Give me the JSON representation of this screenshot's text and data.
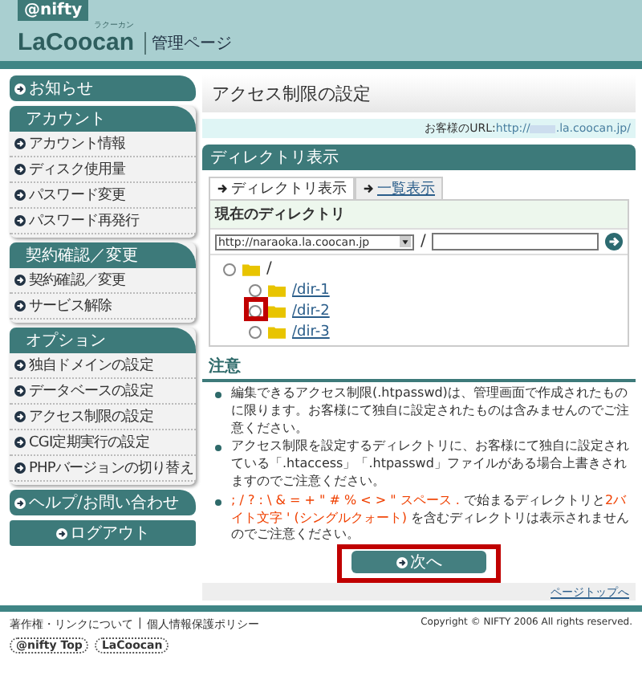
{
  "header": {
    "logo": "@nifty",
    "brand": "LaCoocan",
    "brand_ruby": "ラクーカン",
    "page_label": "管理ページ"
  },
  "sidebar": [
    {
      "kind": "single",
      "label": "お知らせ"
    },
    {
      "kind": "group",
      "title": "アカウント",
      "items": [
        "アカウント情報",
        "ディスク使用量",
        "パスワード変更",
        "パスワード再発行"
      ]
    },
    {
      "kind": "group",
      "title": "契約確認／変更",
      "items": [
        "契約確認／変更",
        "サービス解除"
      ]
    },
    {
      "kind": "group",
      "title": "オプション",
      "items": [
        "独自ドメインの設定",
        "データベースの設定",
        "アクセス制限の設定",
        "CGI定期実行の設定",
        "PHPバージョンの切り替え"
      ]
    },
    {
      "kind": "single",
      "label": "ヘルプ/お問い合わせ"
    },
    {
      "kind": "logout",
      "label": "ログアウト"
    }
  ],
  "main": {
    "title": "アクセス制限の設定",
    "url_label": "お客様のURL:",
    "url_start": "http://",
    "url_end": ".la.coocan.jp/",
    "section_title": "ディレクトリ表示",
    "tabs": [
      {
        "label": "ディレクトリ表示",
        "selected": true
      },
      {
        "label": "一覧表示",
        "selected": false
      }
    ],
    "current_dir_label": "現在のディレクトリ",
    "domain_select": "http://naraoka.la.coocan.jp",
    "separator": "/",
    "tree": {
      "label": "/",
      "selected": false,
      "children": [
        {
          "label": "/dir-1",
          "selected": false
        },
        {
          "label": "/dir-2",
          "selected": false
        },
        {
          "label": "/dir-3",
          "selected": false
        }
      ]
    },
    "notes_title": "注意",
    "notes": [
      [
        {
          "text": "編集できるアクセス制限(.htpasswd)は、管理画面で作成されたものに限ります。お客様にて独自に設定されたものは含みませんのでご注意ください。",
          "highlight": false
        }
      ],
      [
        {
          "text": "アクセス制限を設定するディレクトリに、お客様にて独自に設定されている「.htaccess」「.htpasswd」ファイルがある場合上書きされますのでご注意ください。",
          "highlight": false
        }
      ],
      [
        {
          "text": "; / ? : \\ & = + \" # % < > \" スペース .",
          "highlight": true
        },
        {
          "text": " で始まるディレクトリと",
          "highlight": false
        },
        {
          "text": "2バイト文字 ' (シングルクォート)",
          "highlight": true
        },
        {
          "text": " を含むディレクトリは表示されませんのでご注意ください。",
          "highlight": false
        }
      ]
    ],
    "next_button": "次へ",
    "page_top": "ページトップへ"
  },
  "footer": {
    "links": [
      "著作権・リンクについて",
      "個人情報保護ポリシー"
    ],
    "divider": "|",
    "copyright": "Copyright © NIFTY 2006 All rights reserved.",
    "badges": [
      "@nifty Top",
      "LaCoocan"
    ]
  }
}
